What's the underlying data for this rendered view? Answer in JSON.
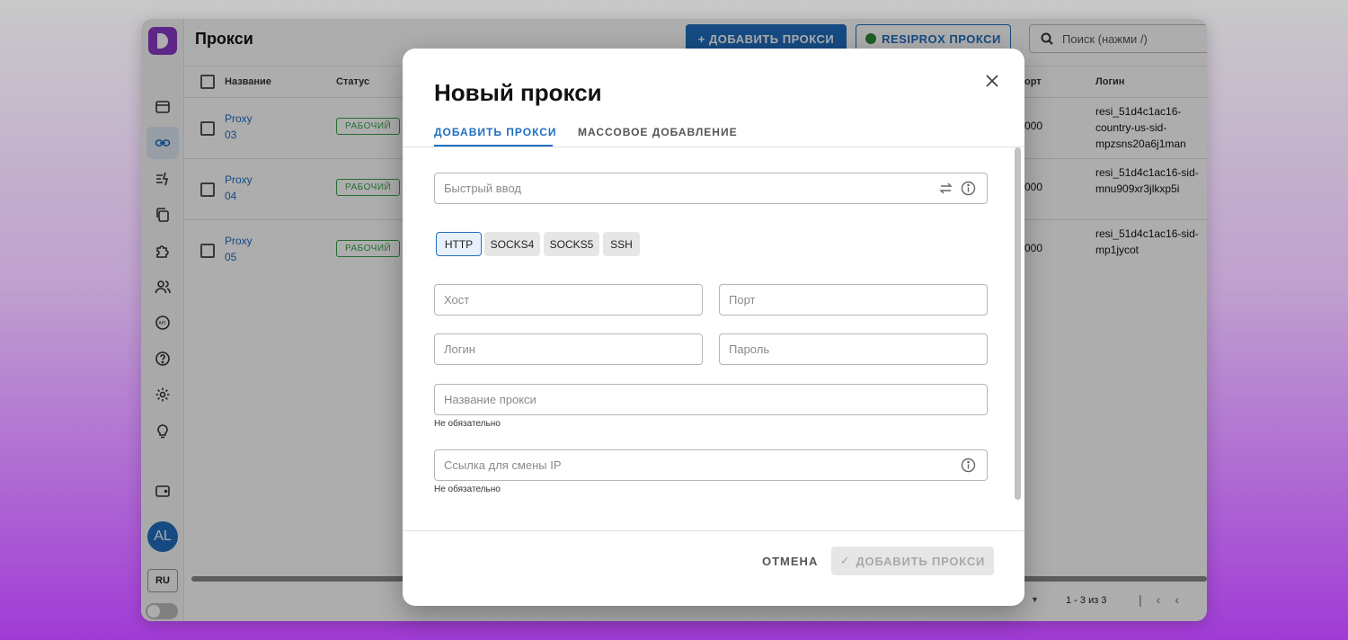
{
  "app": {
    "title": "Прокси",
    "add_button": "+ ДОБАВИТЬ ПРОКСИ",
    "resi_button": "RESIPROX ПРОКСИ",
    "search_placeholder": "Поиск (нажми /)",
    "avatar": "AL",
    "lang": "RU",
    "columns": {
      "name": "Название",
      "status": "Статус",
      "port": "орт",
      "login": "Логин"
    },
    "rows": [
      {
        "name": "Proxy 03",
        "status": "РАБОЧИЙ",
        "port": "000",
        "login": "resi_51d4c1ac16-country-us-sid-mpzsns20a6j1man"
      },
      {
        "name": "Proxy 04",
        "status": "РАБОЧИЙ",
        "port": "000",
        "login": "resi_51d4c1ac16-sid-mnu909xr3jlkxp5i"
      },
      {
        "name": "Proxy 05",
        "status": "РАБОЧИЙ",
        "port": "000",
        "login": "resi_51d4c1ac16-sid-mp1jycot"
      }
    ],
    "pagination": "1 - 3 из 3"
  },
  "modal": {
    "title": "Новый прокси",
    "tabs": [
      "ДОБАВИТЬ ПРОКСИ",
      "МАССОВОЕ ДОБАВЛЕНИЕ"
    ],
    "quick_input_placeholder": "Быстрый ввод",
    "protocols": [
      "HTTP",
      "SOCKS4",
      "SOCKS5",
      "SSH"
    ],
    "selected_protocol": "HTTP",
    "host_placeholder": "Хост",
    "port_placeholder": "Порт",
    "login_placeholder": "Логин",
    "password_placeholder": "Пароль",
    "name_placeholder": "Название прокси",
    "name_helper": "Не обязательно",
    "ip_link_placeholder": "Ссылка для смены IP",
    "ip_link_helper": "Не обязательно",
    "cancel": "ОТМЕНА",
    "submit": "ДОБАВИТЬ ПРОКСИ"
  },
  "colors": {
    "accent": "#1f6fc0",
    "success": "#3aa34a",
    "brand": "#8b3ac8"
  }
}
